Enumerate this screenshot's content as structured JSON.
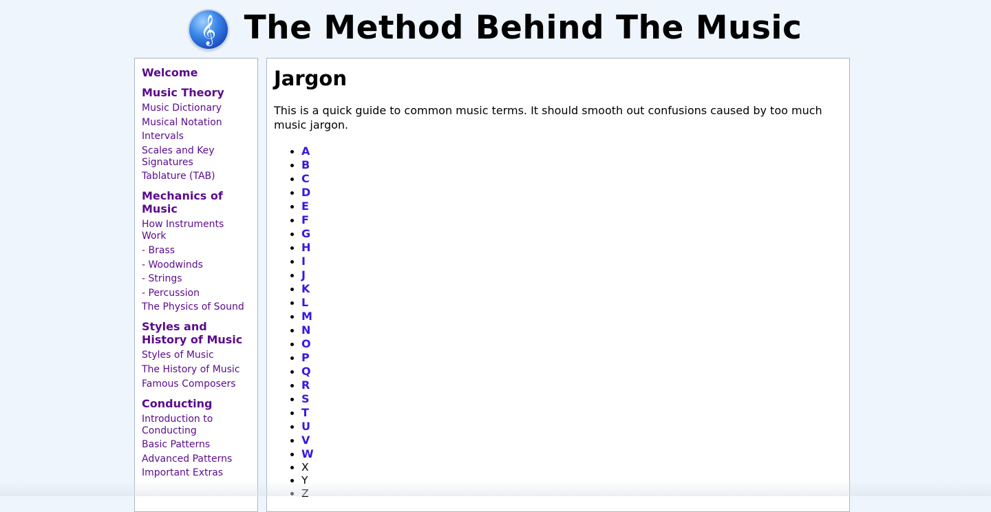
{
  "header": {
    "logo_icon": "treble-clef-icon",
    "logo_glyph": "𝄞",
    "title": "The Method Behind The Music"
  },
  "sidebar": {
    "welcome": "Welcome",
    "groups": [
      {
        "heading": "Music Theory",
        "links": [
          "Music Dictionary",
          "Musical Notation",
          "Intervals",
          "Scales and Key Signatures",
          "Tablature (TAB)"
        ]
      },
      {
        "heading": "Mechanics of Music",
        "links": [
          "How Instruments Work",
          "- Brass",
          "- Woodwinds",
          "- Strings",
          "- Percussion",
          "The Physics of Sound"
        ]
      },
      {
        "heading": "Styles and History of Music",
        "links": [
          "Styles of Music",
          "The History of Music",
          "Famous Composers"
        ]
      },
      {
        "heading": "Conducting",
        "links": [
          "Introduction to Conducting",
          "Basic Patterns",
          "Advanced Patterns",
          "Important Extras"
        ]
      }
    ]
  },
  "content": {
    "title": "Jargon",
    "intro": "This is a quick guide to common music terms. It should smooth out confusions caused by too much music jargon.",
    "letters": [
      {
        "letter": "A",
        "link": true
      },
      {
        "letter": "B",
        "link": true
      },
      {
        "letter": "C",
        "link": true
      },
      {
        "letter": "D",
        "link": true
      },
      {
        "letter": "E",
        "link": true
      },
      {
        "letter": "F",
        "link": true
      },
      {
        "letter": "G",
        "link": true
      },
      {
        "letter": "H",
        "link": true
      },
      {
        "letter": "I",
        "link": true
      },
      {
        "letter": "J",
        "link": true
      },
      {
        "letter": "K",
        "link": true
      },
      {
        "letter": "L",
        "link": true
      },
      {
        "letter": "M",
        "link": true
      },
      {
        "letter": "N",
        "link": true
      },
      {
        "letter": "O",
        "link": true
      },
      {
        "letter": "P",
        "link": true
      },
      {
        "letter": "Q",
        "link": true
      },
      {
        "letter": "R",
        "link": true
      },
      {
        "letter": "S",
        "link": true
      },
      {
        "letter": "T",
        "link": true
      },
      {
        "letter": "U",
        "link": true
      },
      {
        "letter": "V",
        "link": true
      },
      {
        "letter": "W",
        "link": true
      },
      {
        "letter": "X",
        "link": false
      },
      {
        "letter": "Y",
        "link": false
      },
      {
        "letter": "Z",
        "link": false
      }
    ]
  },
  "colors": {
    "page_background": "#eef5fd",
    "nav_link": "#5a0a8c",
    "letter_link": "#3b16e0",
    "panel_border": "#a9b7c6"
  }
}
